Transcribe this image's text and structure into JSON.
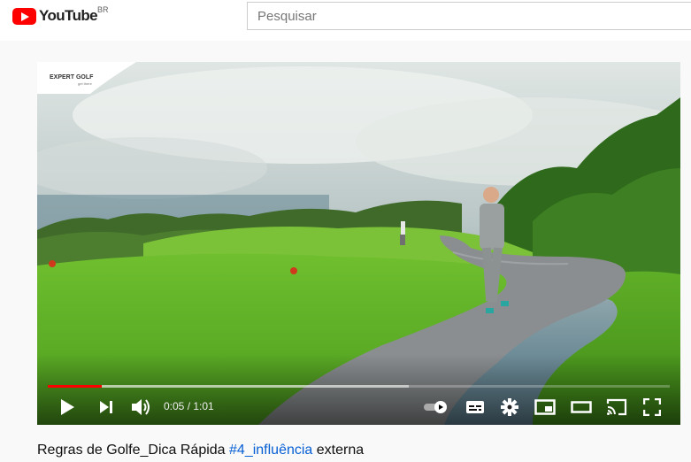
{
  "header": {
    "logo_text": "YouTube",
    "country_code": "BR",
    "search_placeholder": "Pesquisar"
  },
  "video": {
    "channel_watermark": "EXPERT GOLF",
    "watermark_tagline": "get there",
    "current_time": "0:05",
    "duration": "1:01",
    "time_display": "0:05 / 1:01",
    "played_fraction": 0.087,
    "buffered_fraction": 0.58
  },
  "controls": {
    "icons": [
      "play-icon",
      "next-icon",
      "volume-icon",
      "autoplay-toggle-icon",
      "subtitles-icon",
      "settings-icon",
      "miniplayer-icon",
      "theater-mode-icon",
      "cast-icon",
      "fullscreen-icon"
    ]
  },
  "title": {
    "prefix": "Regras de Golfe_Dica Rápida ",
    "hashtag": "#4_influência",
    "suffix": " externa"
  },
  "colors": {
    "brand_red": "#ff0000",
    "link_blue": "#065fd4",
    "page_bg": "#f9f9f9"
  }
}
